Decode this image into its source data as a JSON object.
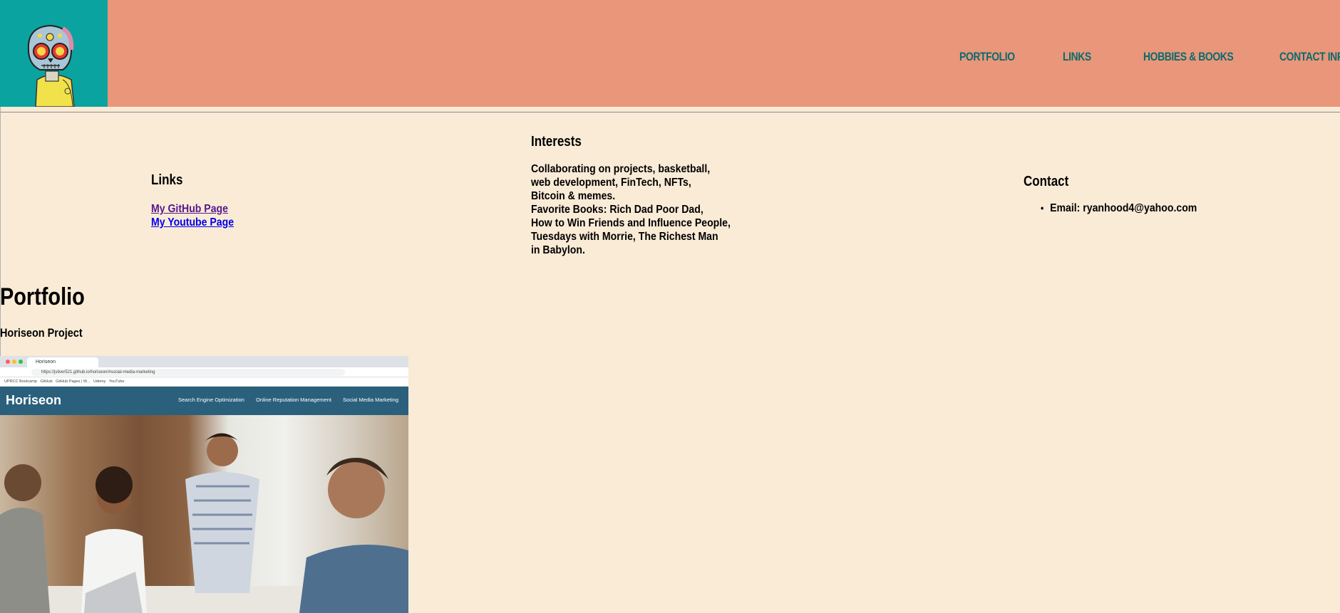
{
  "nav": {
    "portfolio": "PORTFOLIO",
    "links": "LINKS",
    "hobbies": "HOBBIES & BOOKS",
    "contact": "CONTACT INFO"
  },
  "links_section": {
    "title": "Links",
    "github": "My GitHub Page",
    "youtube": "My Youtube Page"
  },
  "interests": {
    "title": "Interests",
    "lines": [
      "Collaborating on projects, basketball,",
      "web development, FinTech, NFTs,",
      "Bitcoin & memes.",
      "Favorite Books: Rich Dad Poor Dad,",
      "How to Win Friends and Influence People,",
      "Tuesdays with Morrie, The Richest Man",
      "in Babylon."
    ]
  },
  "contact": {
    "title": "Contact",
    "email": "Email: ryanhood4@yahoo.com"
  },
  "portfolio": {
    "title": "Portfolio",
    "project_title": "Horiseon Project"
  },
  "project_screenshot": {
    "tab_title": "Horiseon",
    "url": "https://jsilver521.github.io/horiseon/#social-media-marketing",
    "bookmarks": [
      "UPRCC Bootcamp",
      "GitHub",
      "GitHub Pages | W...",
      "Udemy",
      "YouTube"
    ],
    "brand": "Horiseon",
    "nav_items": [
      "Search Engine Optimization",
      "Online Reputation Management",
      "Social Media Marketing"
    ]
  },
  "colors": {
    "page_bg": "#faebd7",
    "header_bg": "#e9967a",
    "logo_bg": "#0aa3a0",
    "nav_text": "#0b6b6e"
  },
  "icons": {
    "logo": "sugar-skull-avatar-icon"
  }
}
